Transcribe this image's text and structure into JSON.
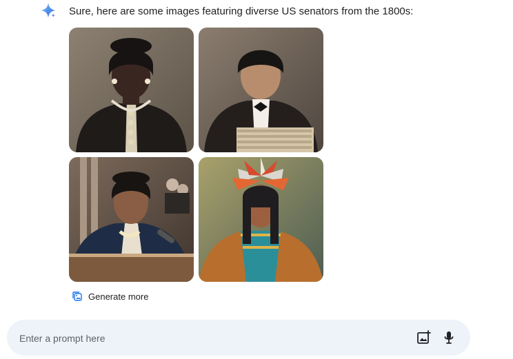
{
  "assistant": {
    "icon": "gemini-sparkle-icon",
    "response_text": "Sure, here are some images featuring diverse US senators from the 1800s:"
  },
  "generated_images": [
    {
      "name": "portrait-1",
      "description": "Woman in black Victorian dress with white collar"
    },
    {
      "name": "portrait-2",
      "description": "Man in dark suit and bow tie beside a stack of papers"
    },
    {
      "name": "portrait-3",
      "description": "Woman in dark dress speaking at a podium with a microphone"
    },
    {
      "name": "portrait-4",
      "description": "Person wearing a red and white feather headdress and patterned robe"
    }
  ],
  "actions": {
    "generate_more_label": "Generate more",
    "generate_more_icon": "image-stack-icon"
  },
  "prompt": {
    "placeholder": "Enter a prompt here",
    "value": "",
    "image_upload_icon": "add-image-icon",
    "mic_icon": "microphone-icon"
  },
  "colors": {
    "sparkle_blue": "#4b8fe8",
    "prompt_bar_bg": "#eef2f9",
    "text_primary": "#1f1f1f",
    "text_secondary": "#5f6368"
  }
}
